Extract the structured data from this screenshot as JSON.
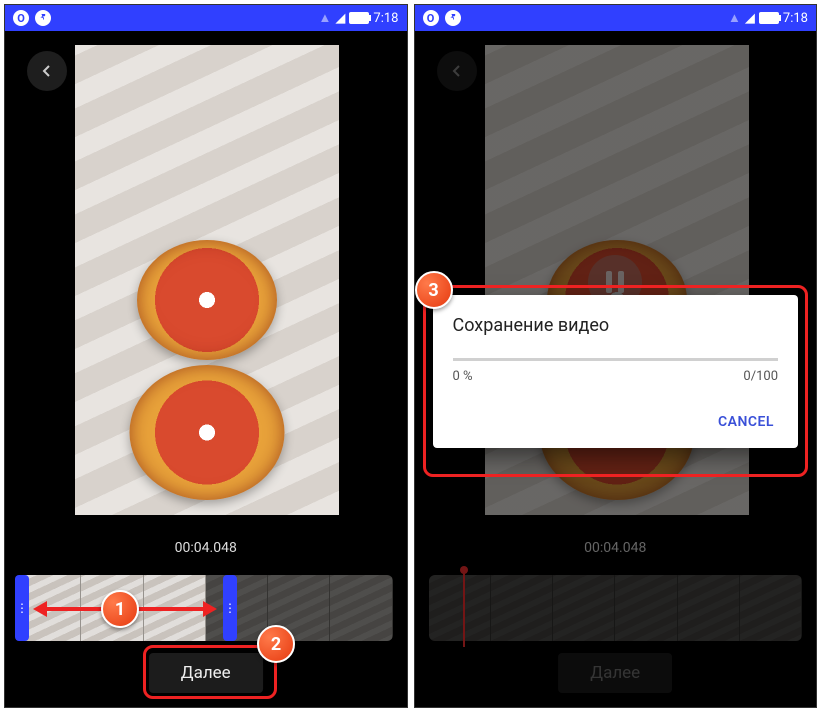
{
  "status": {
    "time": "7:18"
  },
  "editor": {
    "timestamp": "00:04.048",
    "next_label": "Далее"
  },
  "dialog": {
    "title": "Сохранение видео",
    "percent": "0 %",
    "count": "0/100",
    "cancel": "CANCEL"
  },
  "steps": {
    "s1": "1",
    "s2": "2",
    "s3": "3"
  }
}
